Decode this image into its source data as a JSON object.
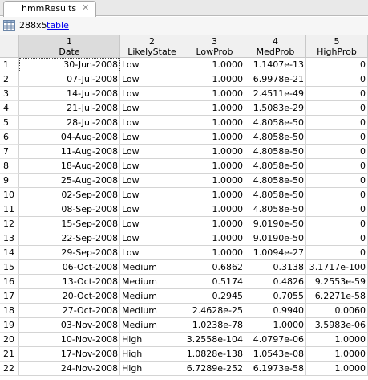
{
  "tab": {
    "title": "hmmResults",
    "close_glyph": "✕"
  },
  "info": {
    "size": "288x5",
    "type_link": "table"
  },
  "columns": [
    {
      "index": "1",
      "name": "Date"
    },
    {
      "index": "2",
      "name": "LikelyState"
    },
    {
      "index": "3",
      "name": "LowProb"
    },
    {
      "index": "4",
      "name": "MedProb"
    },
    {
      "index": "5",
      "name": "HighProb"
    }
  ],
  "rows": [
    [
      "1",
      "30-Jun-2008",
      "Low",
      "1.0000",
      "1.1407e-13",
      "0"
    ],
    [
      "2",
      "07-Jul-2008",
      "Low",
      "1.0000",
      "6.9978e-21",
      "0"
    ],
    [
      "3",
      "14-Jul-2008",
      "Low",
      "1.0000",
      "2.4511e-49",
      "0"
    ],
    [
      "4",
      "21-Jul-2008",
      "Low",
      "1.0000",
      "1.5083e-29",
      "0"
    ],
    [
      "5",
      "28-Jul-2008",
      "Low",
      "1.0000",
      "4.8058e-50",
      "0"
    ],
    [
      "6",
      "04-Aug-2008",
      "Low",
      "1.0000",
      "4.8058e-50",
      "0"
    ],
    [
      "7",
      "11-Aug-2008",
      "Low",
      "1.0000",
      "4.8058e-50",
      "0"
    ],
    [
      "8",
      "18-Aug-2008",
      "Low",
      "1.0000",
      "4.8058e-50",
      "0"
    ],
    [
      "9",
      "25-Aug-2008",
      "Low",
      "1.0000",
      "4.8058e-50",
      "0"
    ],
    [
      "10",
      "02-Sep-2008",
      "Low",
      "1.0000",
      "4.8058e-50",
      "0"
    ],
    [
      "11",
      "08-Sep-2008",
      "Low",
      "1.0000",
      "4.8058e-50",
      "0"
    ],
    [
      "12",
      "15-Sep-2008",
      "Low",
      "1.0000",
      "9.0190e-50",
      "0"
    ],
    [
      "13",
      "22-Sep-2008",
      "Low",
      "1.0000",
      "9.0190e-50",
      "0"
    ],
    [
      "14",
      "29-Sep-2008",
      "Low",
      "1.0000",
      "1.0094e-27",
      "0"
    ],
    [
      "15",
      "06-Oct-2008",
      "Medium",
      "0.6862",
      "0.3138",
      "3.1717e-100"
    ],
    [
      "16",
      "13-Oct-2008",
      "Medium",
      "0.5174",
      "0.4826",
      "9.2553e-59"
    ],
    [
      "17",
      "20-Oct-2008",
      "Medium",
      "0.2945",
      "0.7055",
      "6.2271e-58"
    ],
    [
      "18",
      "27-Oct-2008",
      "Medium",
      "2.4628e-25",
      "0.9940",
      "0.0060"
    ],
    [
      "19",
      "03-Nov-2008",
      "Medium",
      "1.0238e-78",
      "1.0000",
      "3.5983e-06"
    ],
    [
      "20",
      "10-Nov-2008",
      "High",
      "3.2558e-104",
      "4.0797e-06",
      "1.0000"
    ],
    [
      "21",
      "17-Nov-2008",
      "High",
      "1.0828e-138",
      "1.0543e-08",
      "1.0000"
    ],
    [
      "22",
      "24-Nov-2008",
      "High",
      "6.7289e-252",
      "6.1973e-58",
      "1.0000"
    ]
  ]
}
